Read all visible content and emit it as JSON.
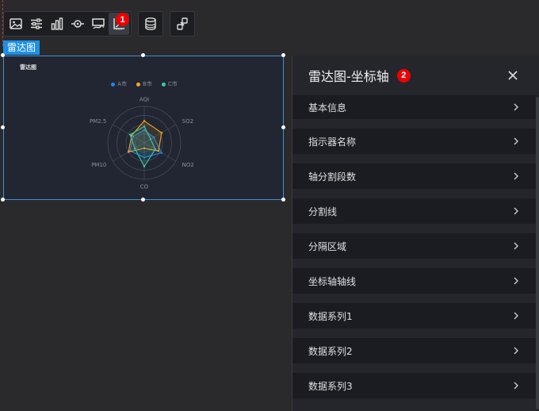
{
  "toolbar": {
    "groups": [
      [
        "image-icon",
        "sliders-icon",
        "bar-chart-icon",
        "target-icon",
        "card-icon",
        "axis-icon"
      ],
      [
        "database-icon"
      ],
      [
        "link-icon"
      ]
    ],
    "active": "axis-icon",
    "badge": "1"
  },
  "component_label": "雷达图",
  "widget": {
    "title": "雷达图"
  },
  "chart_data": {
    "type": "radar",
    "title": "雷达图",
    "indicators": [
      "AQI",
      "SO2",
      "NO2",
      "CO",
      "PM10",
      "PM2.5"
    ],
    "max": 100,
    "series": [
      {
        "name": "A市",
        "color": "#1e88e5",
        "values": [
          35,
          30,
          55,
          40,
          45,
          35
        ]
      },
      {
        "name": "B市",
        "color": "#f5a623",
        "values": [
          60,
          55,
          45,
          15,
          50,
          40
        ]
      },
      {
        "name": "C市",
        "color": "#3ec9a7",
        "values": [
          45,
          20,
          35,
          65,
          30,
          45
        ]
      }
    ],
    "legend": "top-center"
  },
  "panel": {
    "title": "雷达图-坐标轴",
    "badge": "2",
    "sections": [
      {
        "label": "基本信息"
      },
      {
        "label": "指示器名称"
      },
      {
        "label": "轴分割段数"
      },
      {
        "label": "分割线"
      },
      {
        "label": "分隔区域"
      },
      {
        "label": "坐标轴轴线"
      },
      {
        "label": "数据系列1"
      },
      {
        "label": "数据系列2"
      },
      {
        "label": "数据系列3"
      }
    ]
  }
}
